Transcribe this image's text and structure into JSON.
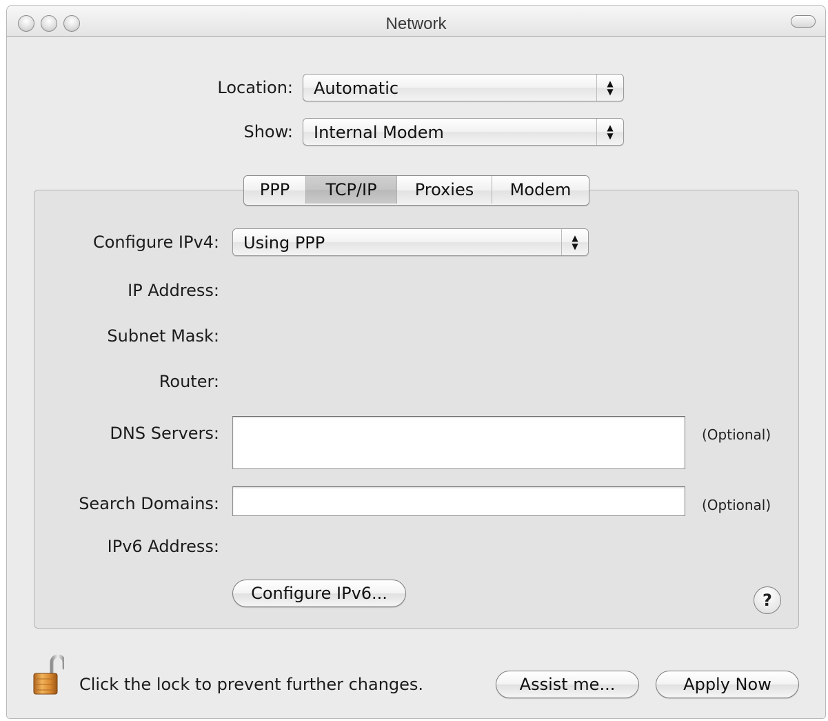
{
  "window": {
    "title": "Network"
  },
  "location": {
    "label": "Location:",
    "value": "Automatic"
  },
  "show": {
    "label": "Show:",
    "value": "Internal Modem"
  },
  "tabs": [
    {
      "label": "PPP",
      "active": false
    },
    {
      "label": "TCP/IP",
      "active": true
    },
    {
      "label": "Proxies",
      "active": false
    },
    {
      "label": "Modem",
      "active": false
    }
  ],
  "tcpip": {
    "configure_ipv4": {
      "label": "Configure IPv4:",
      "value": "Using PPP"
    },
    "ip_address_label": "IP Address:",
    "subnet_mask_label": "Subnet Mask:",
    "router_label": "Router:",
    "dns_servers": {
      "label": "DNS Servers:",
      "value": "",
      "hint": "(Optional)"
    },
    "search_domains": {
      "label": "Search Domains:",
      "value": "",
      "hint": "(Optional)"
    },
    "ipv6_address_label": "IPv6 Address:",
    "configure_ipv6_button": "Configure IPv6...",
    "help_button": "?"
  },
  "footer": {
    "lock_text": "Click the lock to prevent further changes.",
    "assist_button": "Assist me...",
    "apply_button": "Apply Now"
  },
  "icons": {
    "lock": "unlocked-padlock-icon",
    "popup_arrows": "up-down-arrows-icon"
  }
}
